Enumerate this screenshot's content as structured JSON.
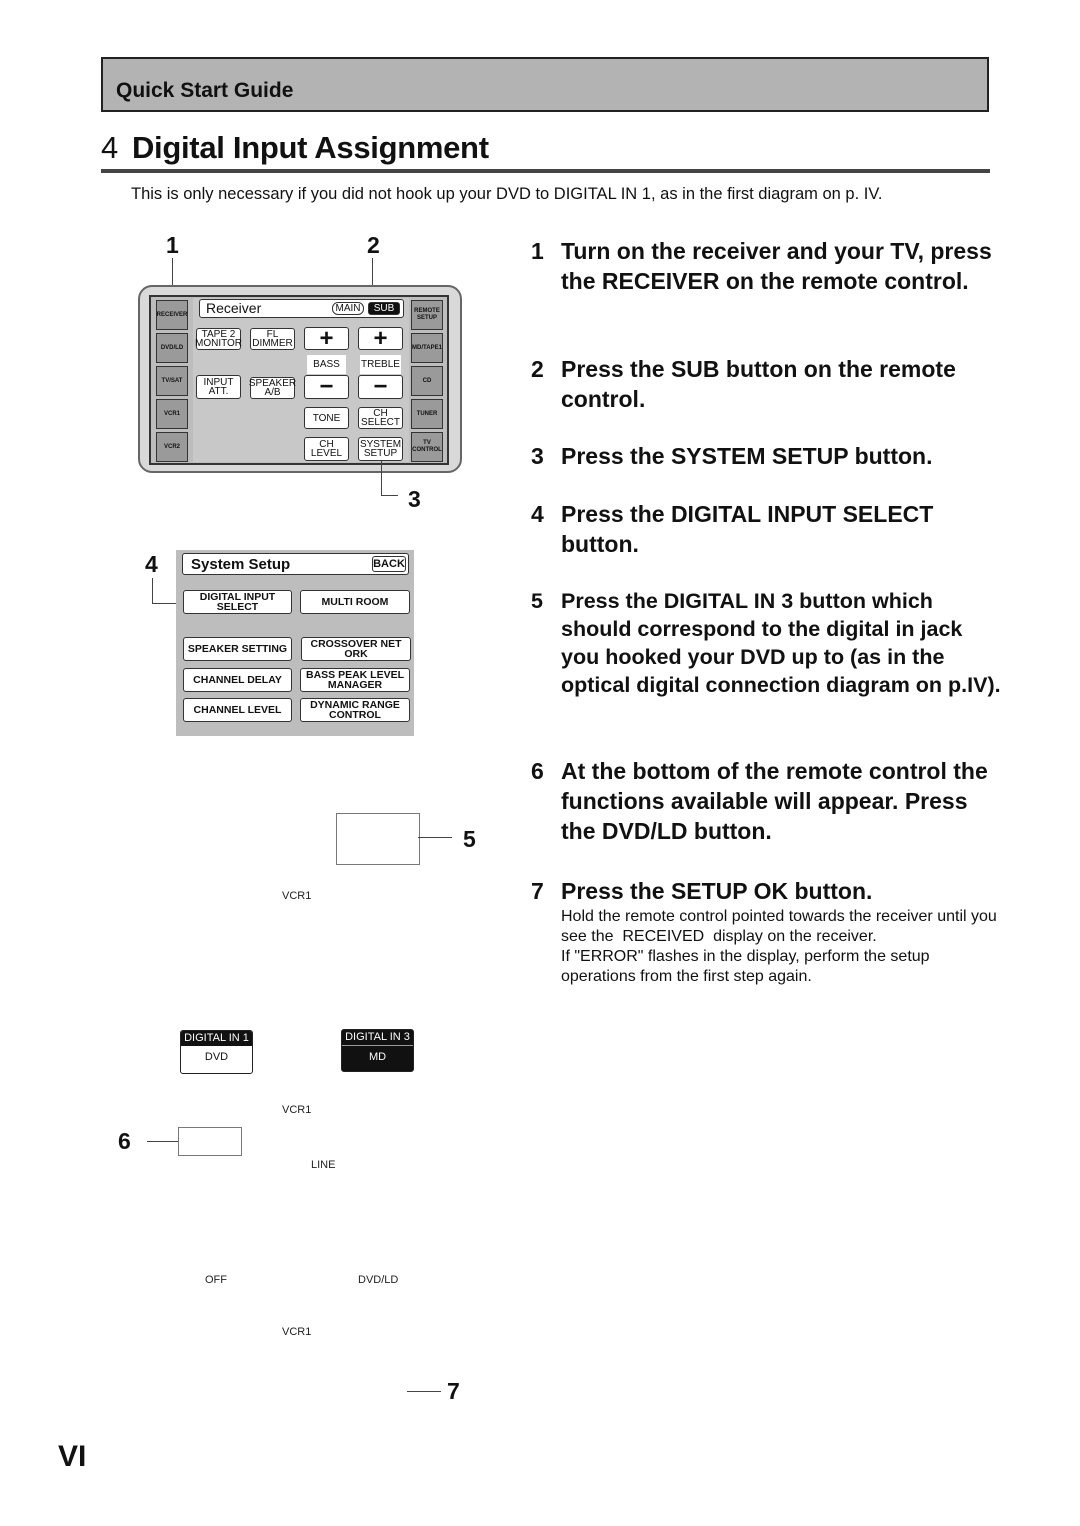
{
  "header": {
    "section": "Quick Start Guide"
  },
  "title": {
    "number": "4",
    "text": "Digital Input Assignment"
  },
  "intro": "This is only necessary if you did not hook up your DVD to DIGITAL IN 1, as in the first diagram on p. IV.",
  "callouts": {
    "c1": "1",
    "c2": "2",
    "c3": "3",
    "c4": "4",
    "c5": "5",
    "c6": "6",
    "c7": "7"
  },
  "remote": {
    "title": "Receiver",
    "main": "MAIN",
    "sub": "SUB",
    "left_buttons": [
      "RECEIVER",
      "DVD/LD",
      "TV/SAT",
      "VCR1",
      "VCR2"
    ],
    "right_buttons": [
      "REMOTE SETUP",
      "MD/TAPE1",
      "CD",
      "TUNER",
      "TV CONTROL"
    ],
    "tape2": "TAPE 2 MONITOR",
    "fl_dimmer": "FL DIMMER",
    "input_att": "INPUT ATT.",
    "speaker_ab": "SPEAKER A/B",
    "plus": "+",
    "minus": "−",
    "bass": "BASS",
    "treble": "TREBLE",
    "tone": "TONE",
    "ch_select": "CH SELECT",
    "ch_level": "CH LEVEL",
    "system_setup": "SYSTEM SETUP"
  },
  "system_setup": {
    "title": "System Setup",
    "back": "BACK",
    "buttons": [
      "DIGITAL INPUT SELECT",
      "MULTI ROOM",
      "SPEAKER SETTING",
      "CROSSOVER NET ORK",
      "CHANNEL DELAY",
      "BASS PEAK LEVEL MANAGER",
      "CHANNEL LEVEL",
      "DYNAMIC RANGE CONTROL"
    ]
  },
  "display_labels": {
    "vcr1_a": "VCR1",
    "vcr1_b": "VCR1",
    "line": "LINE",
    "off": "OFF",
    "dvdld": "DVD/LD",
    "vcr1_c": "VCR1"
  },
  "digital_inputs": [
    {
      "label": "DIGITAL IN 1",
      "value": "DVD",
      "selected": false
    },
    {
      "label": "DIGITAL IN 3",
      "value": "MD",
      "selected": true
    }
  ],
  "steps": [
    {
      "n": "1",
      "text": "Turn on the receiver and your TV, press the RECEIVER on the remote control."
    },
    {
      "n": "2",
      "text": "Press the SUB button on the remote control."
    },
    {
      "n": "3",
      "text": "Press the SYSTEM SETUP button."
    },
    {
      "n": "4",
      "text": "Press the DIGITAL INPUT SELECT button."
    },
    {
      "n": "5",
      "text": "Press the DIGITAL IN 3 button which should correspond to the digital in jack you hooked your DVD up to (as in the optical digital connection diagram on p.IV)."
    },
    {
      "n": "6",
      "text": "At the bottom of the remote control the functions available will appear. Press the DVD/LD button."
    },
    {
      "n": "7",
      "text": "Press the SETUP OK button."
    }
  ],
  "step7_body": [
    "Hold the remote control pointed towards the receiver until you see the  RECEIVED  display on the receiver.",
    "If \"ERROR\" flashes in the display, perform the setup operations from the first step again."
  ],
  "page_number": "VI"
}
